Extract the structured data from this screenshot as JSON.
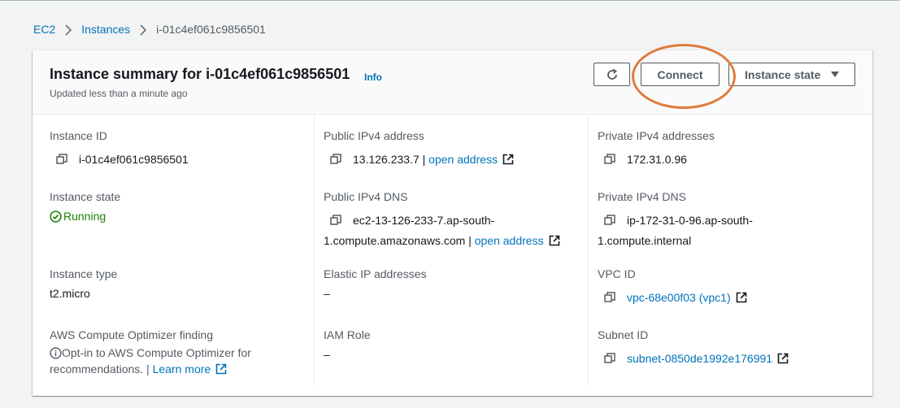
{
  "breadcrumb": {
    "items": [
      "EC2",
      "Instances"
    ],
    "current": "i-01c4ef061c9856501"
  },
  "header": {
    "title": "Instance summary for i-01c4ef061c9856501",
    "info": "Info",
    "subtitle": "Updated less than a minute ago"
  },
  "buttons": {
    "connect": "Connect",
    "instance_state": "Instance state"
  },
  "fields": {
    "instance_id": {
      "label": "Instance ID",
      "value": "i-01c4ef061c9856501"
    },
    "public_ipv4": {
      "label": "Public IPv4 address",
      "value": "13.126.233.7 |",
      "link": "open address"
    },
    "private_ipv4": {
      "label": "Private IPv4 addresses",
      "value": "172.31.0.96"
    },
    "instance_state": {
      "label": "Instance state",
      "value": "Running"
    },
    "public_dns": {
      "label": "Public IPv4 DNS",
      "value_line1": "ec2-13-126-233-7.ap-south-",
      "value_line2": "1.compute.amazonaws.com |",
      "link": "open address"
    },
    "private_dns": {
      "label": "Private IPv4 DNS",
      "value_line1": "ip-172-31-0-96.ap-south-",
      "value_line2": "1.compute.internal"
    },
    "instance_type": {
      "label": "Instance type",
      "value": "t2.micro"
    },
    "elastic_ip": {
      "label": "Elastic IP addresses",
      "value": "–"
    },
    "vpc_id": {
      "label": "VPC ID",
      "value": "vpc-68e00f03 (vpc1)"
    },
    "optimizer": {
      "label": "AWS Compute Optimizer finding",
      "line1": "Opt-in to AWS Compute Optimizer for",
      "line2": "recommendations. |",
      "link": "Learn more"
    },
    "iam_role": {
      "label": "IAM Role",
      "value": "–"
    },
    "subnet_id": {
      "label": "Subnet ID",
      "value": "subnet-0850de1992e176991"
    }
  },
  "colors": {
    "link": "#0073bb",
    "success": "#1d8102",
    "highlight": "#e07b3c"
  }
}
